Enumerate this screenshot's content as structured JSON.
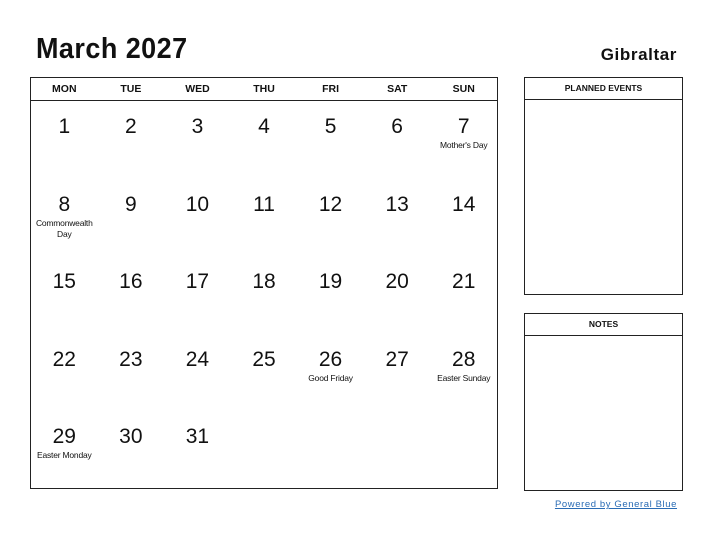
{
  "header": {
    "title": "March 2027",
    "region": "Gibraltar"
  },
  "calendar": {
    "weekdays": [
      "MON",
      "TUE",
      "WED",
      "THU",
      "FRI",
      "SAT",
      "SUN"
    ],
    "weeks": [
      [
        {
          "day": "1",
          "holiday": ""
        },
        {
          "day": "2",
          "holiday": ""
        },
        {
          "day": "3",
          "holiday": ""
        },
        {
          "day": "4",
          "holiday": ""
        },
        {
          "day": "5",
          "holiday": ""
        },
        {
          "day": "6",
          "holiday": ""
        },
        {
          "day": "7",
          "holiday": "Mother's Day"
        }
      ],
      [
        {
          "day": "8",
          "holiday": "Commonwealth Day"
        },
        {
          "day": "9",
          "holiday": ""
        },
        {
          "day": "10",
          "holiday": ""
        },
        {
          "day": "11",
          "holiday": ""
        },
        {
          "day": "12",
          "holiday": ""
        },
        {
          "day": "13",
          "holiday": ""
        },
        {
          "day": "14",
          "holiday": ""
        }
      ],
      [
        {
          "day": "15",
          "holiday": ""
        },
        {
          "day": "16",
          "holiday": ""
        },
        {
          "day": "17",
          "holiday": ""
        },
        {
          "day": "18",
          "holiday": ""
        },
        {
          "day": "19",
          "holiday": ""
        },
        {
          "day": "20",
          "holiday": ""
        },
        {
          "day": "21",
          "holiday": ""
        }
      ],
      [
        {
          "day": "22",
          "holiday": ""
        },
        {
          "day": "23",
          "holiday": ""
        },
        {
          "day": "24",
          "holiday": ""
        },
        {
          "day": "25",
          "holiday": ""
        },
        {
          "day": "26",
          "holiday": "Good Friday"
        },
        {
          "day": "27",
          "holiday": ""
        },
        {
          "day": "28",
          "holiday": "Easter Sunday"
        }
      ],
      [
        {
          "day": "29",
          "holiday": "Easter Monday"
        },
        {
          "day": "30",
          "holiday": ""
        },
        {
          "day": "31",
          "holiday": ""
        },
        {
          "day": "",
          "holiday": ""
        },
        {
          "day": "",
          "holiday": ""
        },
        {
          "day": "",
          "holiday": ""
        },
        {
          "day": "",
          "holiday": ""
        }
      ]
    ]
  },
  "panels": {
    "planned_events": "PLANNED EVENTS",
    "notes": "NOTES"
  },
  "footer": {
    "link_text": "Powered by General Blue",
    "link_color": "#2a6cb5"
  }
}
